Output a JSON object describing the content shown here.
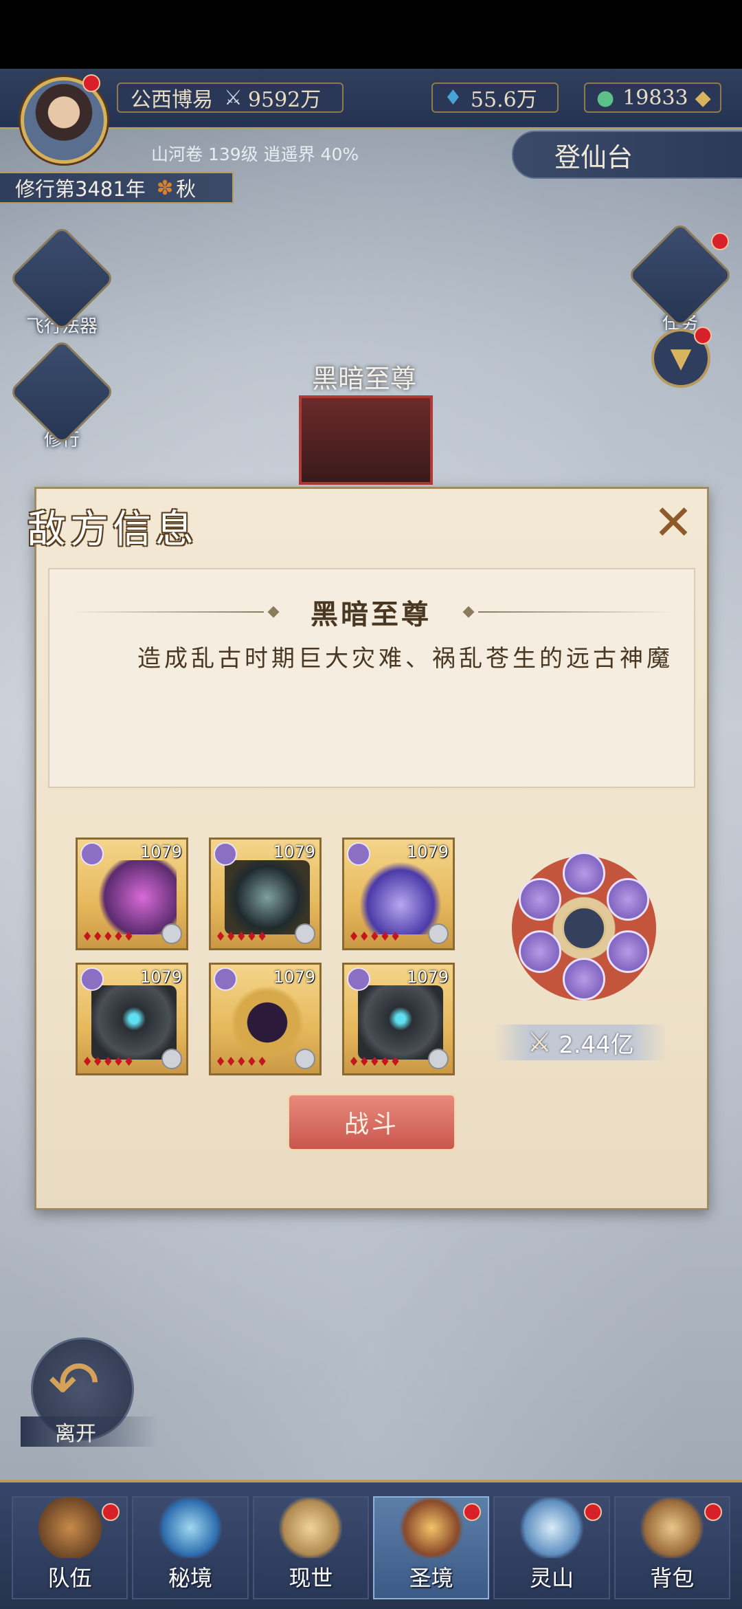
{
  "hud": {
    "guild": "公西博易",
    "power": "9592万",
    "crystals": "55.6万",
    "jade": "19833",
    "realm_line": "山河卷 139级 逍遥界 40%",
    "cultivation_year": "修行第3481年",
    "season": "秋",
    "dengxian_label": "登仙台"
  },
  "side_buttons": {
    "flying_artifact": "飞行法器",
    "cultivate": "修行",
    "tasks": "任务"
  },
  "boss_name_scene": "黑暗至尊",
  "dialog": {
    "title": "敌方信息",
    "enemy_name": "黑暗至尊",
    "description": "造成乱古时期巨大灾难、祸乱苍生的远古神魔",
    "units": [
      {
        "level": "1079",
        "art": "axe-weapon"
      },
      {
        "level": "1079",
        "art": "dark-lord"
      },
      {
        "level": "1079",
        "art": "purple-vase"
      },
      {
        "level": "1079",
        "art": "dark-knight"
      },
      {
        "level": "1079",
        "art": "golden-dragon-orb"
      },
      {
        "level": "1079",
        "art": "dark-knight"
      }
    ],
    "total_power": "2.44亿",
    "fight_label": "战斗"
  },
  "leave_label": "离开",
  "bottom_nav": [
    {
      "label": "队伍",
      "badge": true
    },
    {
      "label": "秘境",
      "badge": false
    },
    {
      "label": "现世",
      "badge": false
    },
    {
      "label": "圣境",
      "badge": true,
      "active": true
    },
    {
      "label": "灵山",
      "badge": true
    },
    {
      "label": "背包",
      "badge": true
    }
  ],
  "colors": {
    "dialog_bg": "#efe3cb",
    "fight_button": "#c9564d",
    "hud_bg": "#243352",
    "accent_gold": "#b89a5c"
  }
}
